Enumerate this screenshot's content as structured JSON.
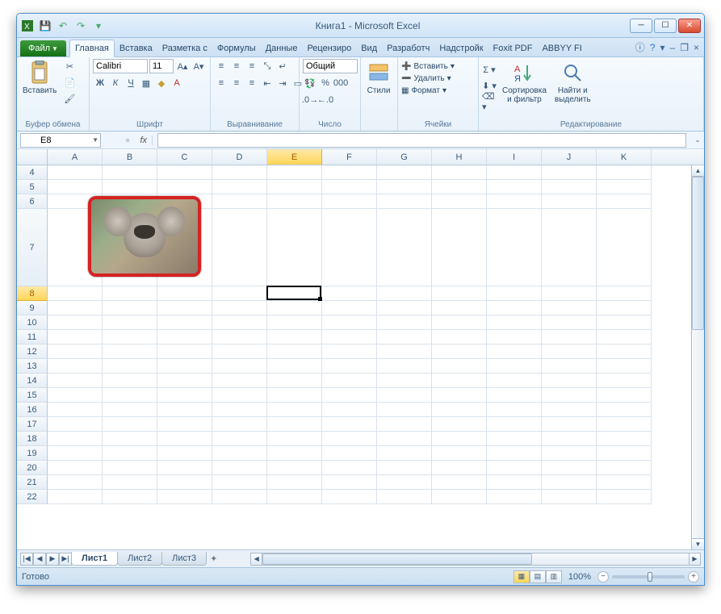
{
  "title": "Книга1 - Microsoft Excel",
  "qat_icons": [
    "excel",
    "save",
    "undo",
    "redo",
    "print",
    "open"
  ],
  "tabs": {
    "file": "Файл",
    "items": [
      "Главная",
      "Вставка",
      "Разметка с",
      "Формулы",
      "Данные",
      "Рецензиро",
      "Вид",
      "Разработч",
      "Надстройк",
      "Foxit PDF",
      "ABBYY FI"
    ],
    "active": 0
  },
  "ribbon": {
    "clipboard": {
      "paste": "Вставить",
      "label": "Буфер обмена"
    },
    "font": {
      "name": "Calibri",
      "size": "11",
      "label": "Шрифт"
    },
    "align": {
      "label": "Выравнивание"
    },
    "number": {
      "format": "Общий",
      "label": "Число"
    },
    "styles": {
      "btn": "Стили",
      "label": ""
    },
    "cells": {
      "insert": "Вставить",
      "delete": "Удалить",
      "format": "Формат",
      "label": "Ячейки"
    },
    "editing": {
      "sort": "Сортировка\nи фильтр",
      "find": "Найти и\nвыделить",
      "label": "Редактирование"
    }
  },
  "namebox": "E8",
  "columns": [
    "A",
    "B",
    "C",
    "D",
    "E",
    "F",
    "G",
    "H",
    "I",
    "J",
    "K"
  ],
  "selected_col": "E",
  "rows": [
    4,
    5,
    6,
    7,
    8,
    9,
    10,
    11,
    12,
    13,
    14,
    15,
    16,
    17,
    18,
    19,
    20,
    21,
    22
  ],
  "tall_row": 7,
  "selected_row": 8,
  "sheets": [
    "Лист1",
    "Лист2",
    "Лист3"
  ],
  "active_sheet": 0,
  "status": {
    "ready": "Готово",
    "zoom": "100%"
  },
  "embedded_image": {
    "alt": "Koala photo",
    "row_anchor": 7,
    "col_anchor": "B"
  }
}
